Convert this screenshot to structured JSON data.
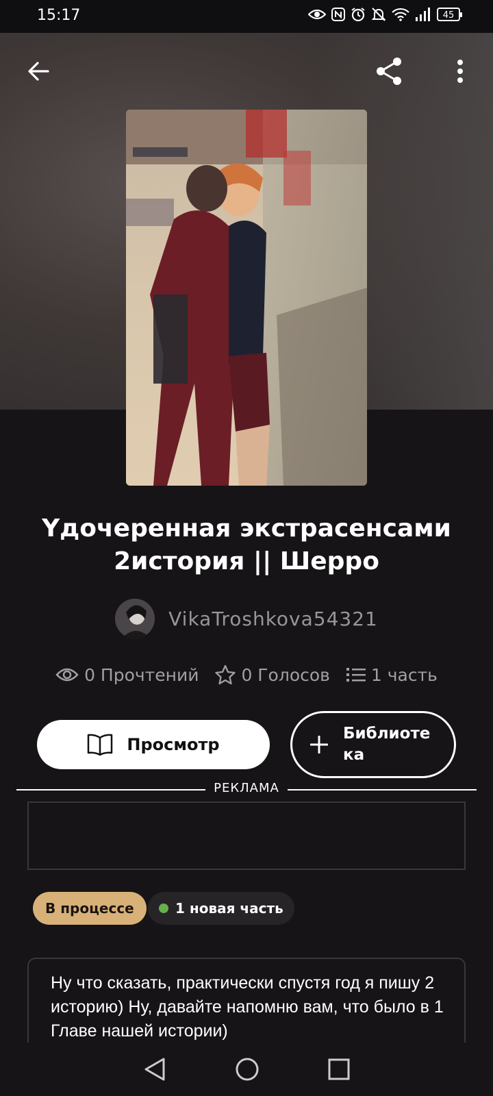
{
  "status_bar": {
    "time": "15:17",
    "battery": "45",
    "icons": [
      "eye-icon",
      "nfc-icon",
      "alarm-icon",
      "mute-icon",
      "wifi-icon",
      "signal-icon",
      "battery-icon"
    ]
  },
  "toolbar": {
    "back_icon": "arrow-left-icon",
    "share_icon": "share-icon",
    "menu_icon": "more-vertical-icon"
  },
  "story": {
    "title_line1": "Үдочеренная экстрасенсами",
    "title_line2": "2история || Шерро",
    "author": "VikaTroshkova54321",
    "stats": {
      "reads": "0 Прочтений",
      "votes": "0 Голосов",
      "parts": "1 часть"
    },
    "view_button": "Просмотр",
    "library_button_line1": "Библиоте",
    "library_button_line2": "ка",
    "ad_label": "РЕКЛАМА",
    "status_tag": "В процессе",
    "new_part_tag": "1 новая часть",
    "description": "Ну что сказать, практически спустя год я пишу 2 историю) Ну, давайте напомню вам, что было в 1 Главе нашей истории)"
  },
  "colors": {
    "background": "#161416",
    "status_tag": "#d8b179",
    "new_dot": "#68b04a"
  },
  "nav": {
    "back": "triangle-back-icon",
    "home": "circle-home-icon",
    "recents": "square-recents-icon"
  }
}
